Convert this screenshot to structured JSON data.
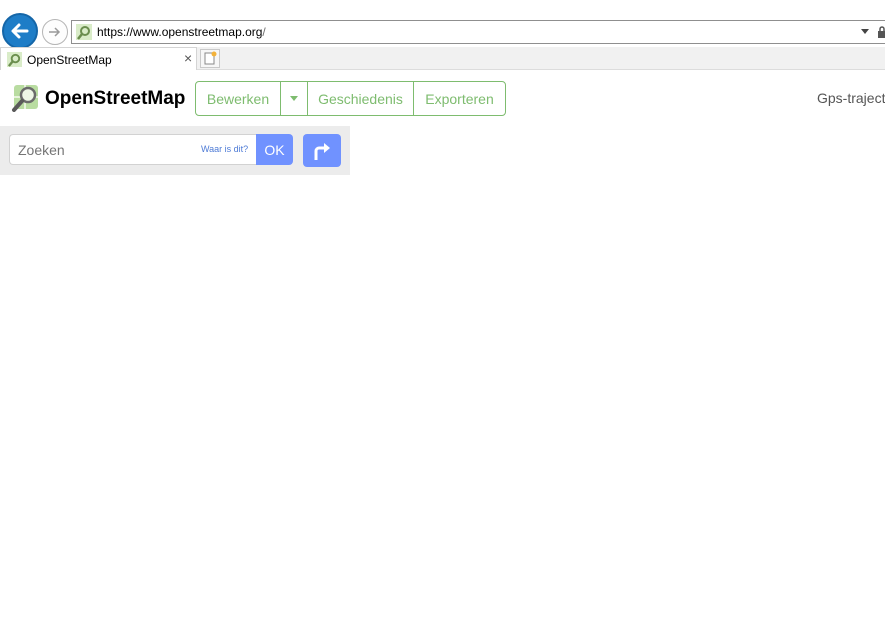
{
  "browser": {
    "url_prefix": "https://www.",
    "url_domain": "openstreetmap.org",
    "url_suffix": "/",
    "tab_title": "OpenStreetMap",
    "tab_close": "×"
  },
  "header": {
    "brand": "OpenStreetMap",
    "edit_label": "Bewerken",
    "history_label": "Geschiedenis",
    "export_label": "Exporteren",
    "gps_label": "Gps-traject"
  },
  "search": {
    "placeholder": "Zoeken",
    "where_link": "Waar is dit?",
    "ok_label": "OK"
  },
  "colors": {
    "osm_green": "#7ebc6f",
    "search_blue": "#7092ff",
    "browser_blue": "#1e7dc7"
  }
}
